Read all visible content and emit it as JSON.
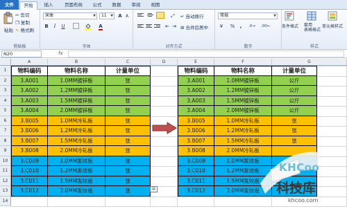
{
  "tabs": [
    "文件",
    "开始",
    "插入",
    "页面布局",
    "公式",
    "数据",
    "审阅",
    "视图"
  ],
  "clipboard": {
    "paste": "粘贴",
    "cut": "剪切",
    "copy": "复制",
    "format_painter": "格式刷",
    "label": "剪贴板"
  },
  "font": {
    "name": "宋体",
    "size": "11",
    "bold": "B",
    "italic": "I",
    "underline": "U",
    "grow": "A",
    "shrink": "A",
    "color_a": "A",
    "label": "字体"
  },
  "alignment": {
    "wrap": "自动换行",
    "merge": "合并后居中",
    "label": "对齐方式"
  },
  "number": {
    "format": "常规",
    "percent": "%",
    "comma": ",",
    "label": "数字"
  },
  "styles": {
    "conditional": "条件格式",
    "table": "套用\n表格格式",
    "cell": "单元格样式",
    "label": "样式"
  },
  "formula_bar": {
    "name_box": "N20",
    "fx": "fx",
    "value": ""
  },
  "col_headers_left": [
    "A",
    "B",
    "C",
    "D",
    "E",
    "F",
    "G"
  ],
  "row_numbers": [
    "1",
    "2",
    "3",
    "4",
    "5",
    "6",
    "7",
    "8",
    "9",
    "10",
    "11",
    "12",
    "13",
    "14"
  ],
  "table_headers": [
    "物料编码",
    "物料名称",
    "计量单位"
  ],
  "table_left": [
    [
      "3.A001",
      "1.0MM镀锌板",
      "张"
    ],
    [
      "3.A002",
      "1.2MM镀锌板",
      "张"
    ],
    [
      "3.A003",
      "1.5MM镀锌板",
      "张"
    ],
    [
      "3.A004",
      "2.0MM镀锌板",
      "张"
    ],
    [
      "3.B005",
      "1.0MM冷轧板",
      "张"
    ],
    [
      "3.B006",
      "1.2MM冷轧板",
      "张"
    ],
    [
      "3.B007",
      "1.5MM冷轧板",
      "张"
    ],
    [
      "3.B008",
      "2.0MM冷轧板",
      "张"
    ],
    [
      "3.C009",
      "1.0MM发纹板",
      "张"
    ],
    [
      "3.C010",
      "1.2MM发纹板",
      "张"
    ],
    [
      "3.C011",
      "1.5MM发纹板",
      "张"
    ],
    [
      "3.C012",
      "2.0MM发纹板",
      "张"
    ]
  ],
  "table_right": [
    [
      "3.A001",
      "1.0MM镀锌板",
      "公斤"
    ],
    [
      "3.A002",
      "1.2MM镀锌板",
      "公斤"
    ],
    [
      "3.A003",
      "1.5MM镀锌板",
      "公斤"
    ],
    [
      "3.A004",
      "2.0MM镀锌板",
      "公斤"
    ],
    [
      "3.B005",
      "1.0MM冷轧板",
      "张"
    ],
    [
      "3.B006",
      "1.2MM冷轧板",
      "张"
    ],
    [
      "3.B007",
      "1.5MM冷轧板",
      "张"
    ],
    [
      "3.B008",
      "2.0MM冷轧板",
      ""
    ],
    [
      "3.C009",
      "1.0MM发纹板",
      ""
    ],
    [
      "3.C010",
      "1.2MM发纹板",
      ""
    ],
    [
      "3.C011",
      "1.5MM发纹板",
      ""
    ],
    [
      "3.C012",
      "2.0MM发纹板",
      ""
    ]
  ],
  "group_colors": {
    "green": "#92d050",
    "orange": "#ffc000",
    "blue": "#00b0f0",
    "arrow": "#c0504d"
  },
  "watermark": {
    "logo": "KHCoo",
    "cn": "科技库",
    "url": "khcoo.com"
  }
}
